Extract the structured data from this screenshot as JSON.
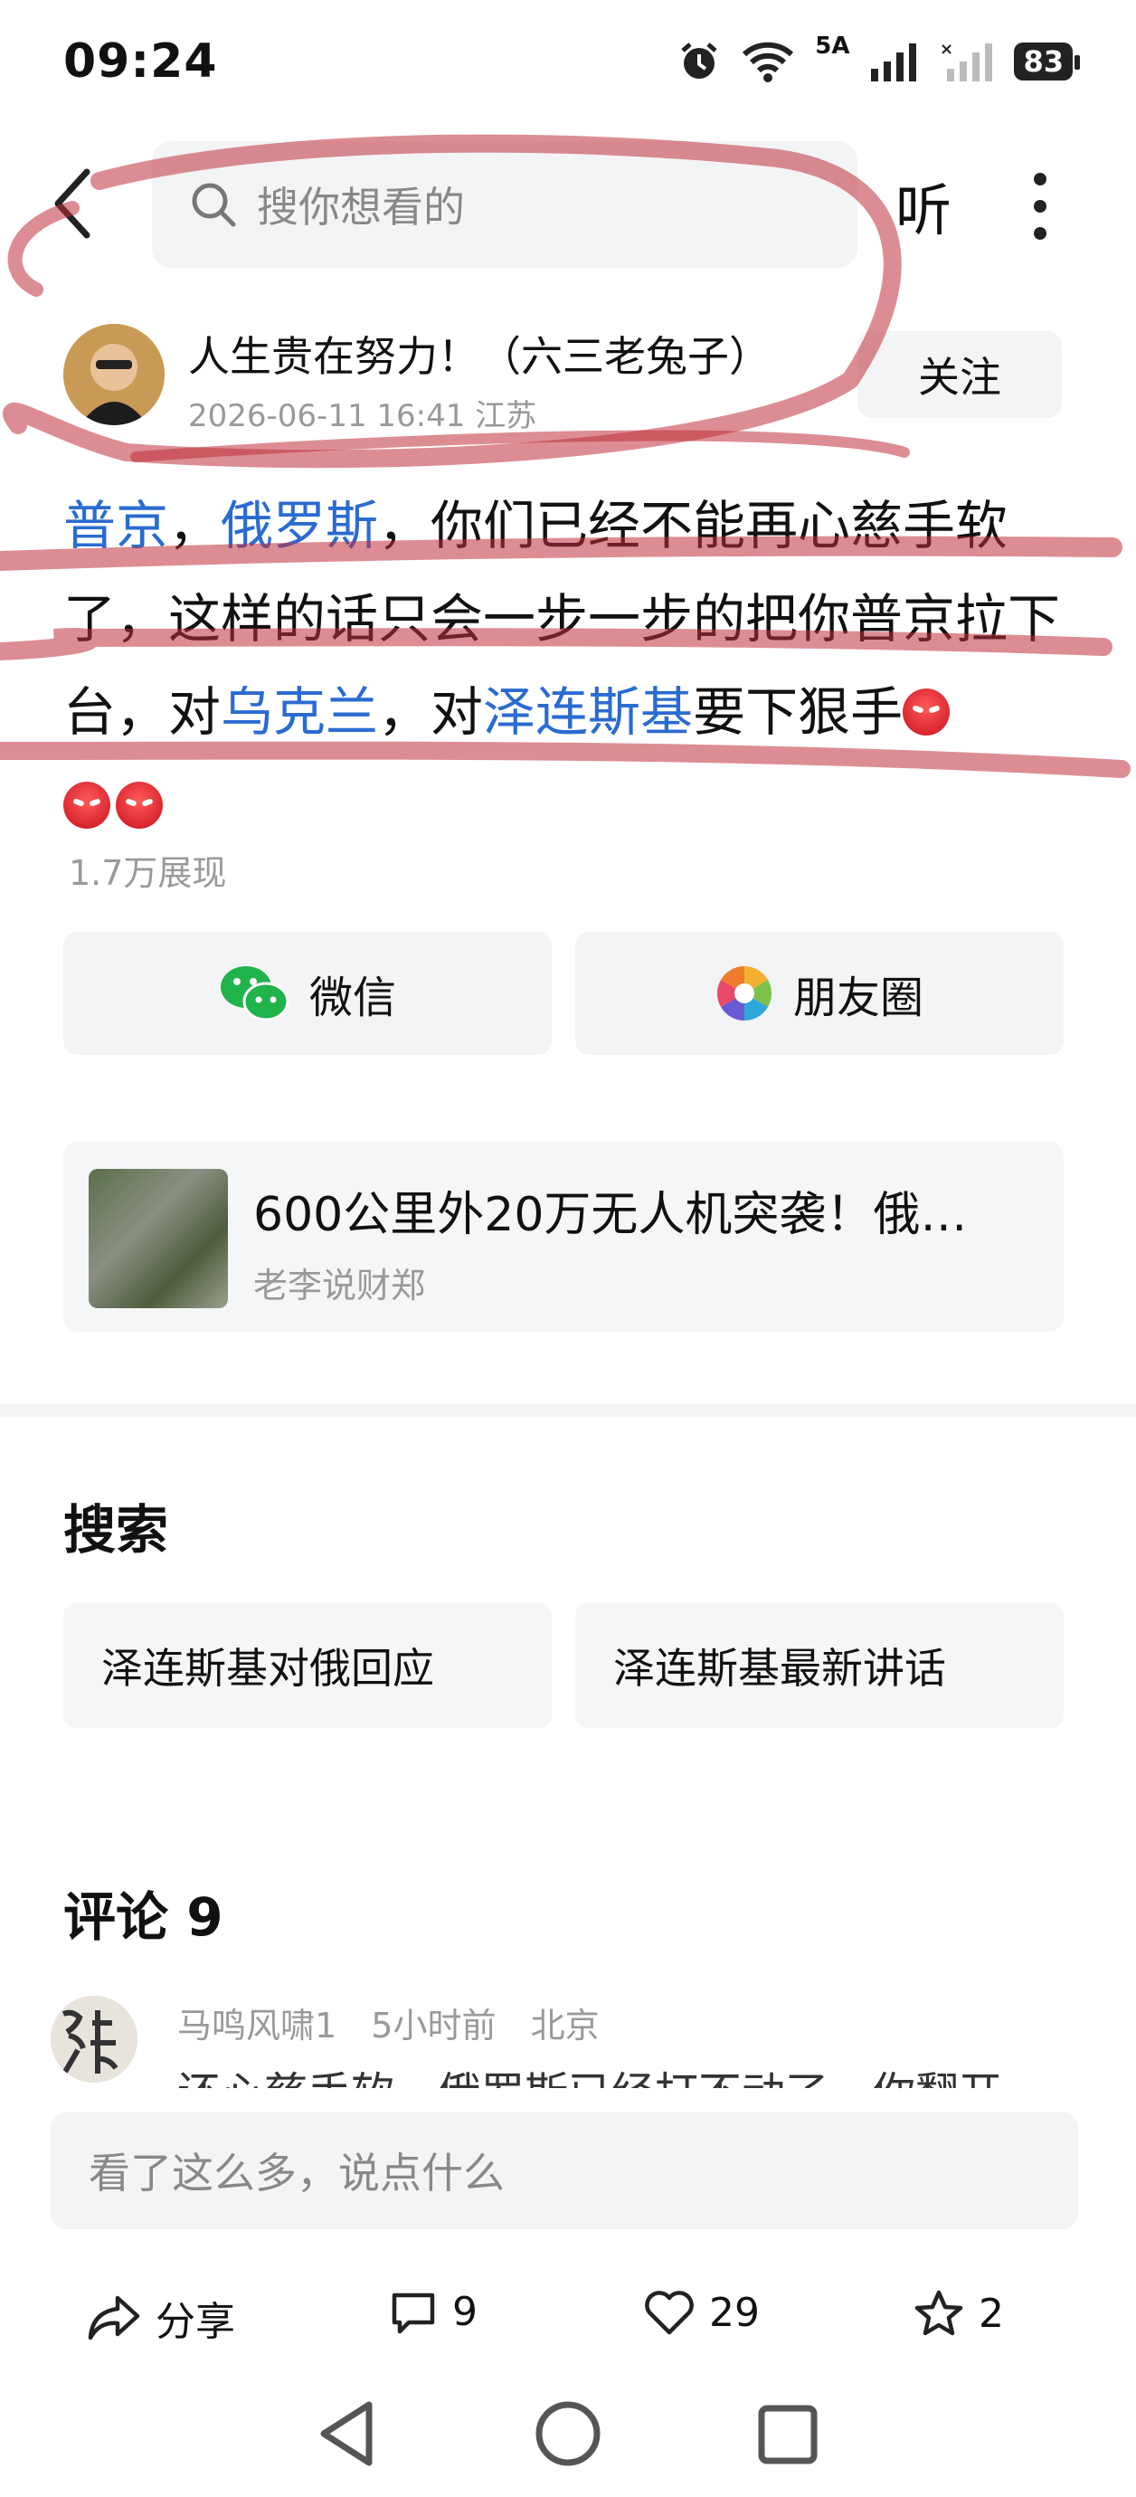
{
  "status_bar": {
    "time": "09:24",
    "network": "5A",
    "battery": "83"
  },
  "top_bar": {
    "search_placeholder": "搜你想看的",
    "listen_label": "听"
  },
  "author": {
    "name": "人生贵在努力！（六三老兔子）",
    "meta": "2026-06-11 16:41 江苏",
    "follow_label": "关注"
  },
  "post": {
    "segments": [
      {
        "text": "普京",
        "link": true
      },
      {
        "text": "，",
        "link": false
      },
      {
        "text": "俄罗斯",
        "link": true
      },
      {
        "text": "，你们已经不能再心慈手软了，这样的话只会一步一步的把你普京拉下台，对",
        "link": false
      },
      {
        "text": "乌克兰",
        "link": true
      },
      {
        "text": "，对",
        "link": false
      },
      {
        "text": "泽连斯基",
        "link": true
      },
      {
        "text": "要下狠手",
        "link": false
      }
    ],
    "views": "1.7万展现"
  },
  "share": {
    "wechat_label": "微信",
    "moments_label": "朋友圈"
  },
  "related": {
    "title": "600公里外20万无人机突袭！俄…",
    "source": "老李说财郑"
  },
  "search_section": {
    "title": "搜索",
    "chips": [
      "泽连斯基对俄回应",
      "泽连斯基最新讲话"
    ]
  },
  "comments": {
    "title": "评论 9",
    "first": {
      "user": "马鸣风啸1",
      "time": "5小时前",
      "location": "北京",
      "text_partial": "还心慈手软，俄罗斯已经打不动了，你翻开"
    },
    "input_placeholder": "看了这么多，说点什么"
  },
  "actions": {
    "share_label": "分享",
    "comment_count": "9",
    "like_count": "29",
    "fav_count": "2"
  },
  "colors": {
    "link": "#2a6bd1",
    "annotation": "#c0303a"
  }
}
